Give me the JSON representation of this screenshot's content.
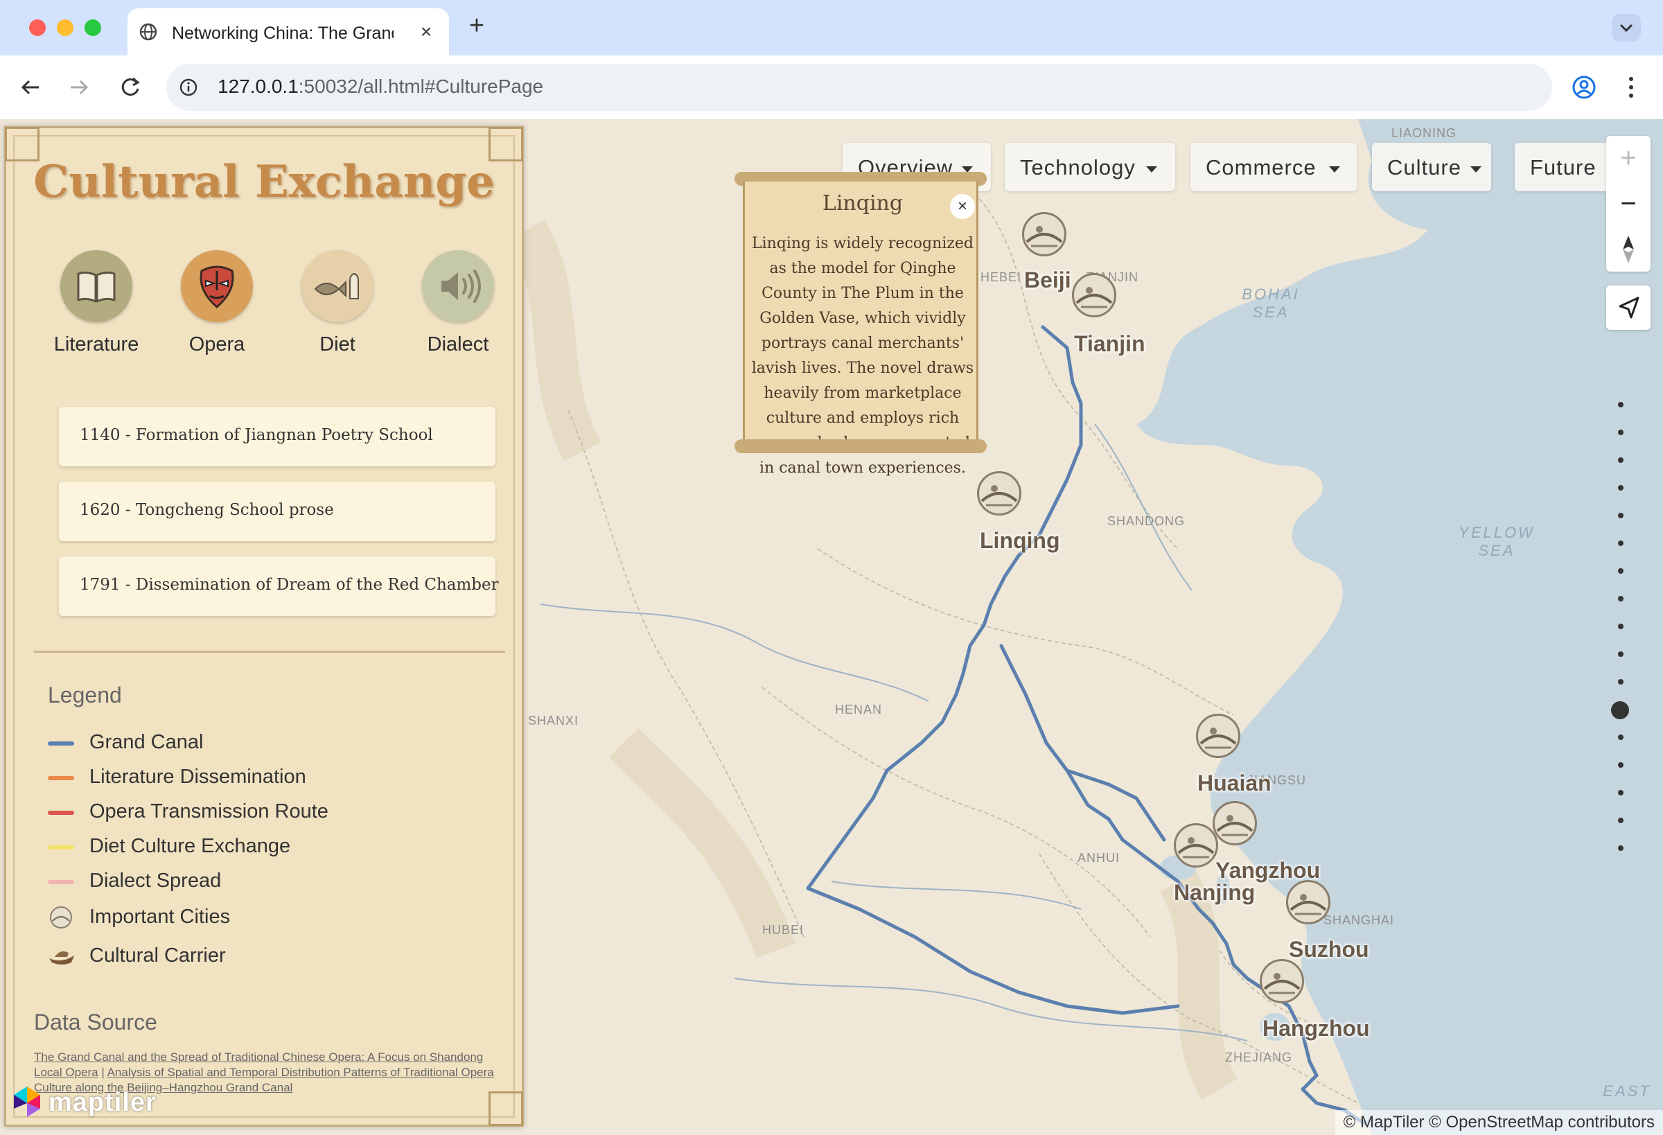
{
  "browser": {
    "tab_title": "Networking China: The Grand Canal",
    "tab_close": "×",
    "new_tab": "+",
    "url_host": "127.0.0.1",
    "url_rest": ":50032/all.html#CulturePage"
  },
  "nav": {
    "items": [
      "Overview",
      "Technology",
      "Commerce",
      "Culture",
      "Future"
    ]
  },
  "map_controls": {
    "zoom_in": "+",
    "zoom_out": "−"
  },
  "popup": {
    "title": "Linqing",
    "close": "×",
    "body": "Linqing is widely recognized as the model for Qinghe County in The Plum in the Golden Vase, which vividly portrays canal merchants' lavish lives. The novel draws heavily from marketplace culture and employs rich vernacular language rooted in canal town experiences."
  },
  "sidebar": {
    "title": "Cultural Exchange",
    "categories": [
      "Literature",
      "Opera",
      "Diet",
      "Dialect"
    ],
    "events": [
      "1140 - Formation of Jiangnan Poetry School",
      "1620 - Tongcheng School prose",
      "1791 - Dissemination of Dream of the Red Chamber"
    ],
    "legend_title": "Legend",
    "legend": [
      {
        "label": "Grand Canal",
        "color": "#5b7fae"
      },
      {
        "label": "Literature Dissemination",
        "color": "#e8894a"
      },
      {
        "label": "Opera Transmission Route",
        "color": "#d9534f"
      },
      {
        "label": "Diet Culture Exchange",
        "color": "#f5e26a"
      },
      {
        "label": "Dialect Spread",
        "color": "#f2b3b3"
      },
      {
        "label": "Important Cities",
        "icon": "city-marker-icon"
      },
      {
        "label": "Cultural Carrier",
        "icon": "boat-icon"
      }
    ],
    "data_source_title": "Data Source",
    "data_source_links": [
      "The Grand Canal and the Spread of Traditional Chinese Opera: A Focus on Shandong Local Opera",
      "Analysis of Spatial and Temporal Distribution Patterns of Traditional Opera Culture along the Beijing–Hangzhou Grand Canal"
    ],
    "separator": "|"
  },
  "map": {
    "cities": [
      "Beijing",
      "Tianjin",
      "Linqing",
      "Huaian",
      "Yangzhou",
      "Nanjing",
      "Suzhou",
      "Hangzhou"
    ],
    "beijing_visible": "Beiji",
    "provinces": [
      "LIAONING",
      "HEBEI",
      "TIANJIN",
      "SHANDONG",
      "HENAN",
      "JIANGSU",
      "ANHUI",
      "HUBEI",
      "SHANGHAI",
      "ZHEJIANG",
      "SHANXI"
    ],
    "seas": [
      "BOHAI\nSEA",
      "YELLOW\nSEA",
      "EAST"
    ],
    "logo": "maptiler",
    "attribution": "© MapTiler © OpenStreetMap contributors"
  }
}
